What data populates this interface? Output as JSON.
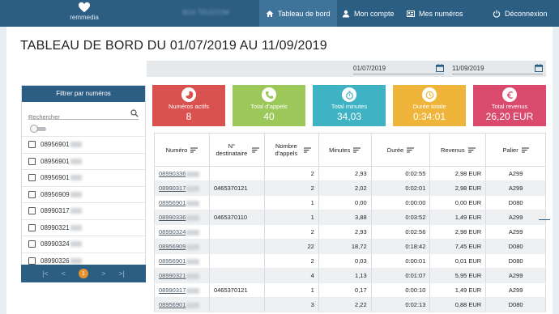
{
  "nav": {
    "logo_text": "remmedia",
    "account": "BOX TELECOM",
    "items": [
      {
        "label": "Tableau de bord",
        "icon": "home-icon",
        "active": true
      },
      {
        "label": "Mon compte",
        "icon": "user-icon",
        "active": false
      },
      {
        "label": "Mes numéros",
        "icon": "list-card-icon",
        "active": false
      },
      {
        "label": "Déconnexion",
        "icon": "power-icon",
        "active": false
      }
    ]
  },
  "page": {
    "title": "TABLEAU DE BORD DU 01/07/2019 AU 11/09/2019",
    "date_from": "01/07/2019",
    "date_to": "11/09/2019"
  },
  "filter": {
    "title": "Filtrer par numéros",
    "search_placeholder": "Rechercher",
    "numbers": [
      "08956901",
      "08956901",
      "08956901",
      "08956909",
      "08990317",
      "08990321",
      "08990324",
      "08990326"
    ],
    "pager": {
      "first": "|<",
      "prev": "<",
      "current": "1",
      "next": ">",
      "last": ">|"
    }
  },
  "cards": [
    {
      "label": "Numéros actifs",
      "value": "8",
      "color": "#d9524f",
      "icon": "pie-chart-icon"
    },
    {
      "label": "Total d'appels",
      "value": "40",
      "color": "#9cc85a",
      "icon": "phone-icon"
    },
    {
      "label": "Total minutes",
      "value": "34,03",
      "color": "#3fb3c3",
      "icon": "stopwatch-icon"
    },
    {
      "label": "Durée totale",
      "value": "0:34:01",
      "color": "#efb53a",
      "icon": "clock-icon"
    },
    {
      "label": "Total revenus",
      "value": "26,20 EUR",
      "color": "#d94a6d",
      "icon": "euro-icon"
    }
  ],
  "table": {
    "headers": [
      "Numéro",
      "N° destinataire",
      "Nombre d'appels",
      "Minutes",
      "Durée",
      "Revenus",
      "Palier"
    ],
    "rows": [
      {
        "numero": "08990336",
        "dest": "",
        "appels": "2",
        "minutes": "2,93",
        "duree": "0:02:55",
        "revenus": "2,98 EUR",
        "palier": "A299"
      },
      {
        "numero": "08990317",
        "dest": "0465370121",
        "appels": "2",
        "minutes": "2,02",
        "duree": "0:02:01",
        "revenus": "2,98 EUR",
        "palier": "A299"
      },
      {
        "numero": "08956901",
        "dest": "",
        "appels": "1",
        "minutes": "0,00",
        "duree": "0:00:00",
        "revenus": "0,00 EUR",
        "palier": "D080"
      },
      {
        "numero": "08990336",
        "dest": "0465370110",
        "appels": "1",
        "minutes": "3,88",
        "duree": "0:03:52",
        "revenus": "1,49 EUR",
        "palier": "A299"
      },
      {
        "numero": "08990324",
        "dest": "",
        "appels": "2",
        "minutes": "2,93",
        "duree": "0:02:56",
        "revenus": "2,98 EUR",
        "palier": "A299"
      },
      {
        "numero": "08956909",
        "dest": "",
        "appels": "22",
        "minutes": "18,72",
        "duree": "0:18:42",
        "revenus": "7,45 EUR",
        "palier": "D080"
      },
      {
        "numero": "08956901",
        "dest": "",
        "appels": "2",
        "minutes": "0,03",
        "duree": "0:00:01",
        "revenus": "0,01 EUR",
        "palier": "D080"
      },
      {
        "numero": "08990321",
        "dest": "",
        "appels": "4",
        "minutes": "1,13",
        "duree": "0:01:07",
        "revenus": "5,95 EUR",
        "palier": "A299"
      },
      {
        "numero": "08990317",
        "dest": "0465370121",
        "appels": "1",
        "minutes": "0,17",
        "duree": "0:00:10",
        "revenus": "1,49 EUR",
        "palier": "A299"
      },
      {
        "numero": "08956901",
        "dest": "",
        "appels": "3",
        "minutes": "2,22",
        "duree": "0:02:13",
        "revenus": "0,88 EUR",
        "palier": "D080"
      }
    ]
  }
}
